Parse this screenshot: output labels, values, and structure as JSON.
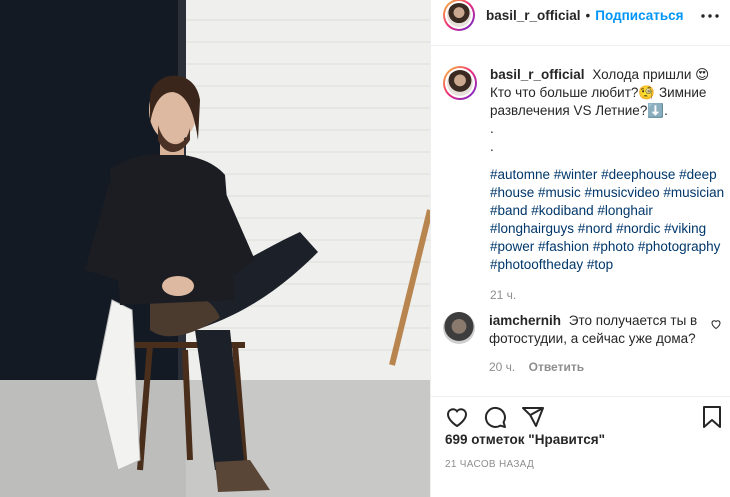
{
  "author": {
    "username": "basil_r_official",
    "follow_label": "Подписаться",
    "dot": "•"
  },
  "caption": {
    "username": "basil_r_official",
    "text_1": "Холода пришли 😍 Кто что больше любит?🧐 Зимние развлечения VS Летние?⬇️.",
    "line_dot_1": ".",
    "line_dot_2": ".",
    "hashtags": "#automne #winter #deephouse #deep #house #music #musicvideo #musician #band #kodiband #longhair #longhairguys #nord #nordic #viking #power #fashion #photo #photography #photooftheday #top",
    "time": "21 ч."
  },
  "comment": {
    "username": "iamchernih",
    "text": "Это получается ты в фотостудии, а сейчас уже дома?",
    "time": "20 ч.",
    "reply_label": "Ответить"
  },
  "likes": "699 отметок \"Нравится\"",
  "posted_ago": "21 часов назад",
  "icons": [
    "more-options-icon",
    "like-icon",
    "comment-icon",
    "share-icon",
    "save-icon",
    "comment-like-icon"
  ]
}
